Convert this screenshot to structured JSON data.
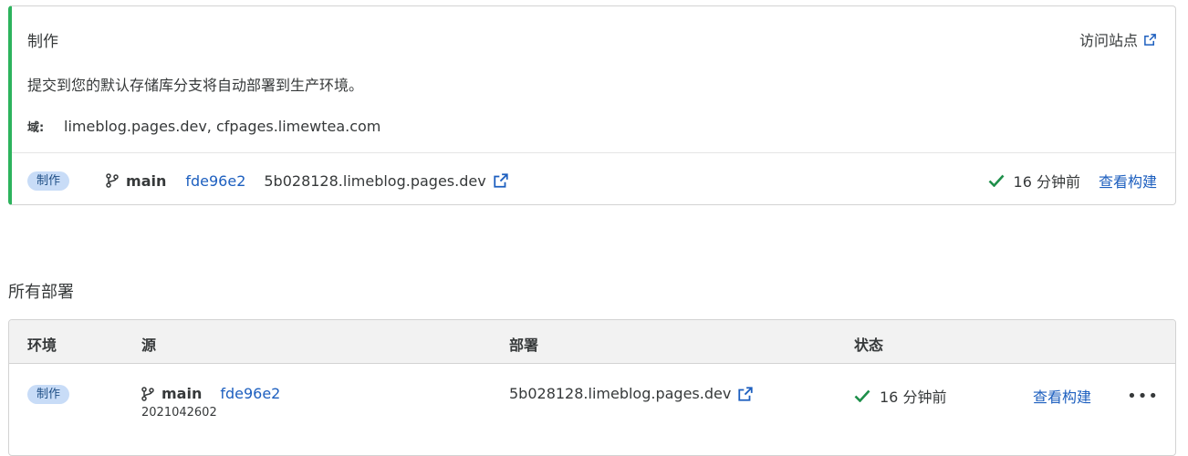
{
  "production": {
    "title": "制作",
    "visit_site": "访问站点",
    "description": "提交到您的默认存储库分支将自动部署到生产环境。",
    "domains_label": "域:",
    "domains_value": "limeblog.pages.dev, cfpages.limewtea.com",
    "badge": "制作",
    "branch": "main",
    "commit": "fde96e2",
    "deploy_url": "5b028128.limeblog.pages.dev",
    "status_time": "16 分钟前",
    "view_build": "查看构建"
  },
  "deployments": {
    "title": "所有部署",
    "columns": {
      "env": "环境",
      "source": "源",
      "deploy": "部署",
      "status": "状态"
    },
    "rows": [
      {
        "badge": "制作",
        "branch": "main",
        "commit": "fde96e2",
        "commit_message": "2021042602",
        "deploy_url": "5b028128.limeblog.pages.dev",
        "status_time": "16 分钟前",
        "view_build": "查看构建",
        "more": "•••"
      }
    ]
  },
  "colors": {
    "accent_green": "#2db35d",
    "link_blue": "#1d5fbf",
    "badge_bg": "#c8dcf7",
    "success_check": "#1e8f4a"
  }
}
